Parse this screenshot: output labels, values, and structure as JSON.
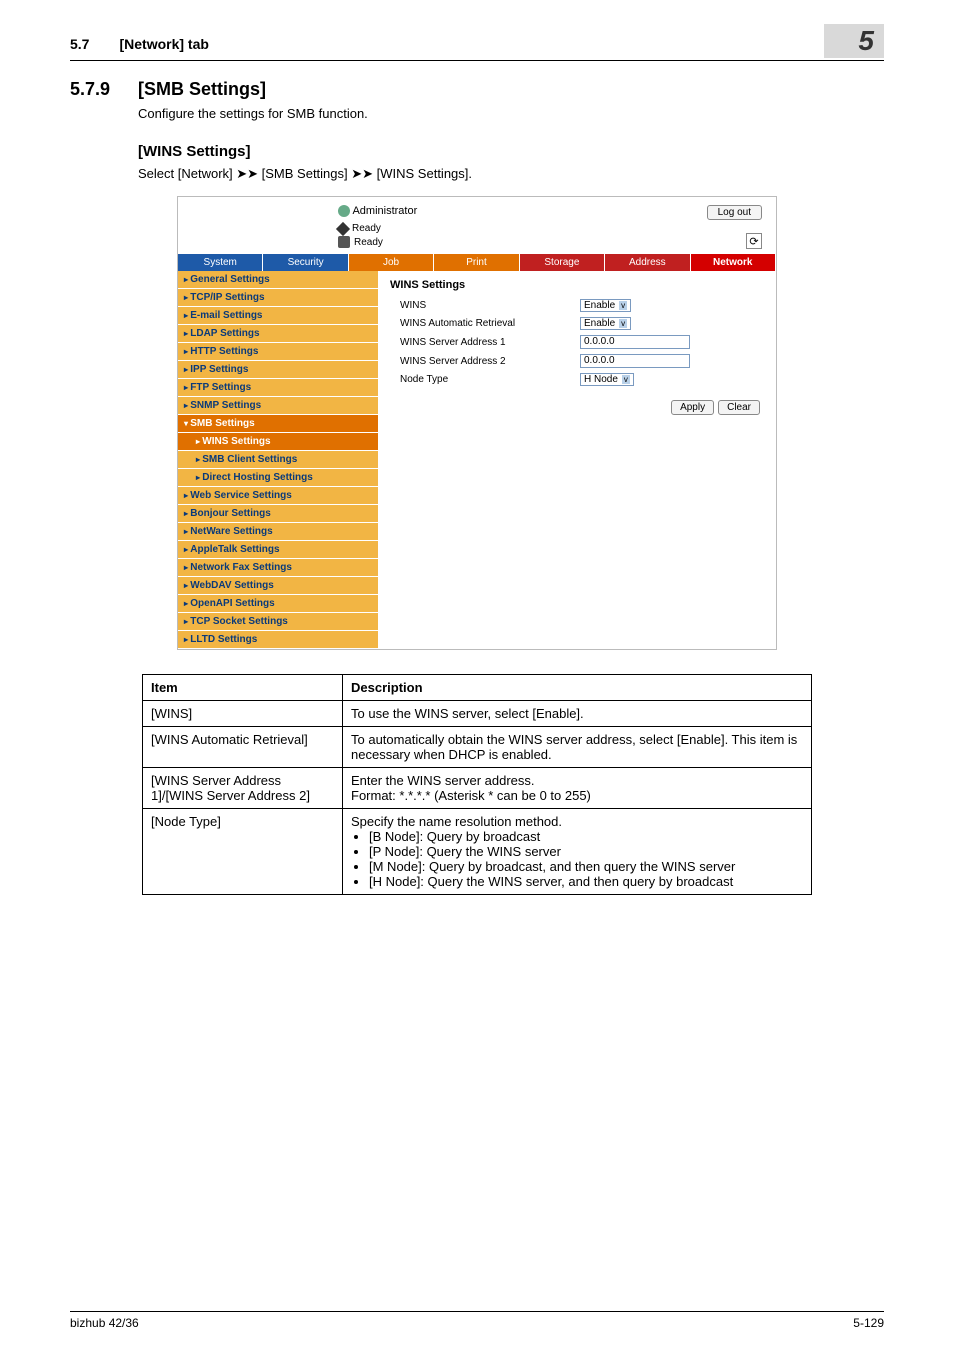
{
  "page_header": {
    "section_number": "5.7",
    "tab_label": "[Network] tab",
    "chapter_badge": "5"
  },
  "section": {
    "number": "5.7.9",
    "title": "[SMB Settings]",
    "intro": "Configure the settings for SMB function.",
    "sub_title": "[WINS Settings]",
    "path": "Select [Network] ➤➤ [SMB Settings] ➤➤ [WINS Settings]."
  },
  "shot": {
    "admin": "Administrator",
    "ready1": "Ready",
    "ready2": "Ready",
    "logout": "Log out",
    "tabs": {
      "system": "System",
      "security": "Security",
      "job": "Job",
      "print": "Print",
      "storage": "Storage",
      "address": "Address",
      "network": "Network"
    },
    "sidebar": {
      "items": [
        "General Settings",
        "TCP/IP Settings",
        "E-mail Settings",
        "LDAP Settings",
        "HTTP Settings",
        "IPP Settings",
        "FTP Settings",
        "SNMP Settings"
      ],
      "smb_parent": "SMB Settings",
      "smb_children": [
        "WINS Settings",
        "SMB Client Settings",
        "Direct Hosting Settings"
      ],
      "after": [
        "Web Service Settings",
        "Bonjour Settings",
        "NetWare Settings",
        "AppleTalk Settings",
        "Network Fax Settings",
        "WebDAV Settings",
        "OpenAPI Settings",
        "TCP Socket Settings",
        "LLTD Settings"
      ]
    },
    "panel": {
      "title": "WINS Settings",
      "rows": {
        "wins": {
          "label": "WINS",
          "value": "Enable"
        },
        "auto": {
          "label": "WINS Automatic Retrieval",
          "value": "Enable"
        },
        "addr1": {
          "label": "WINS Server Address 1",
          "value": "0.0.0.0"
        },
        "addr2": {
          "label": "WINS Server Address 2",
          "value": "0.0.0.0"
        },
        "node": {
          "label": "Node Type",
          "value": "H Node"
        }
      },
      "apply": "Apply",
      "clear": "Clear"
    }
  },
  "table": {
    "head_item": "Item",
    "head_desc": "Description",
    "rows": {
      "r1": {
        "item": "[WINS]",
        "desc": "To use the WINS server, select [Enable]."
      },
      "r2": {
        "item": "[WINS Automatic Retrieval]",
        "desc": "To automatically obtain the WINS server address, select [Enable]. This item is necessary when DHCP is enabled."
      },
      "r3": {
        "item": "[WINS Server Address 1]/[WINS Server Address 2]",
        "desc": "Enter the WINS server address.\nFormat: *.*.*.* (Asterisk * can be 0 to 255)"
      },
      "r4": {
        "item": "[Node Type]",
        "desc_lead": "Specify the name resolution method.",
        "bullets": [
          "[B Node]: Query by broadcast",
          "[P Node]: Query the WINS server",
          "[M Node]: Query by broadcast, and then query the WINS server",
          "[H Node]: Query the WINS server, and then query by broadcast"
        ]
      }
    }
  },
  "footer": {
    "left": "bizhub 42/36",
    "right": "5-129"
  }
}
